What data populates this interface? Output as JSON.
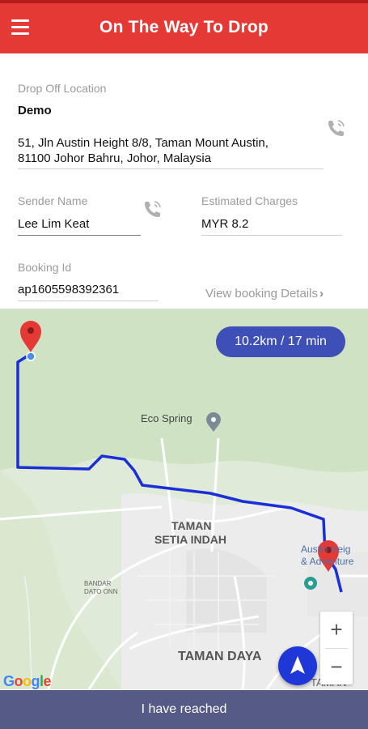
{
  "header": {
    "title": "On The Way To Drop",
    "menu_icon": "hamburger-menu-icon",
    "color": "#e53935"
  },
  "drop_off": {
    "label": "Drop Off Location",
    "name": "Demo",
    "address_line1": "51, Jln Austin Height 8/8, Taman Mount Austin,",
    "address_line2": "81100 Johor Bahru, Johor, Malaysia",
    "call_icon": "phone-call-icon"
  },
  "sender": {
    "label": "Sender Name",
    "value": "Lee Lim Keat",
    "call_icon": "phone-call-icon"
  },
  "charges": {
    "label": "Estimated Charges",
    "value": "MYR 8.2"
  },
  "booking": {
    "label": "Booking Id",
    "value": "ap1605598392361",
    "view_details": "View booking Details"
  },
  "map": {
    "distance_time": "10.2km / 17 min",
    "places": {
      "eco_spring": "Eco Spring",
      "setia_indah_1": "TAMAN",
      "setia_indah_2": "SETIA INDAH",
      "bandar_dato_onn_1": "BANDAR",
      "bandar_dato_onn_2": "DATO ONN",
      "taman_daya": "TAMAN DAYA",
      "austin_1": "Austin Heig",
      "austin_2": "& Adventure",
      "taman_edge": "TAMAN"
    },
    "zoom_in": "+",
    "zoom_out": "−",
    "google_letters": [
      "G",
      "o",
      "o",
      "g",
      "l",
      "e"
    ],
    "google_colors": [
      "#4285F4",
      "#EA4335",
      "#FBBC05",
      "#4285F4",
      "#34A853",
      "#EA4335"
    ],
    "route_color": "#1a2fd6",
    "pin_color": "#e53935"
  },
  "footer": {
    "reached_button": "I have reached",
    "color": "#555a86"
  }
}
